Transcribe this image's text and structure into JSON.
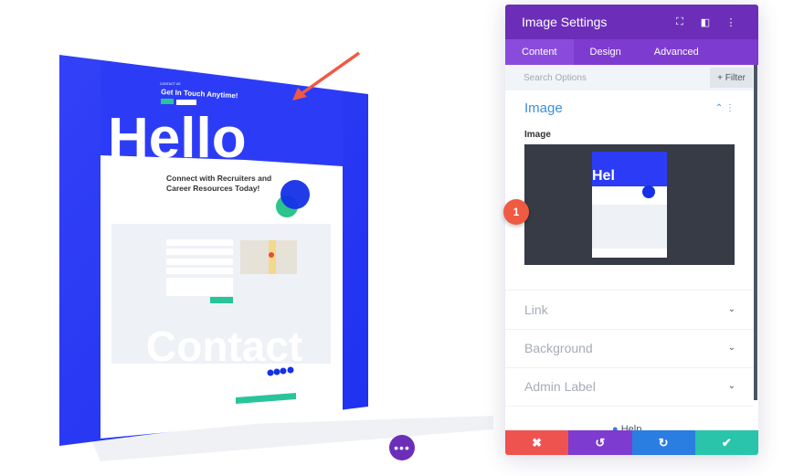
{
  "mockup": {
    "kicker": "CONTACT US",
    "headline": "Get In Touch Anytime!",
    "hero_word": "Hello",
    "section_title_1": "Connect with Recruiters and",
    "section_title_2": "Career Resources Today!",
    "big_word": "Contact"
  },
  "annotation": {
    "badge": "1"
  },
  "panel": {
    "title": "Image Settings",
    "tabs": [
      {
        "label": "Content"
      },
      {
        "label": "Design"
      },
      {
        "label": "Advanced"
      }
    ],
    "search_placeholder": "Search Options",
    "filter_label": "+ Filter",
    "image_section": {
      "title": "Image",
      "field_label": "Image"
    },
    "sections": [
      {
        "label": "Link"
      },
      {
        "label": "Background"
      },
      {
        "label": "Admin Label"
      }
    ],
    "help_label": "Help"
  },
  "colors": {
    "purple": "#6c2eb9",
    "cancel": "#ef5350",
    "undo": "#7d3bcf",
    "redo": "#2a7de1",
    "save": "#29c4a9",
    "accent": "#2b3bf5"
  }
}
